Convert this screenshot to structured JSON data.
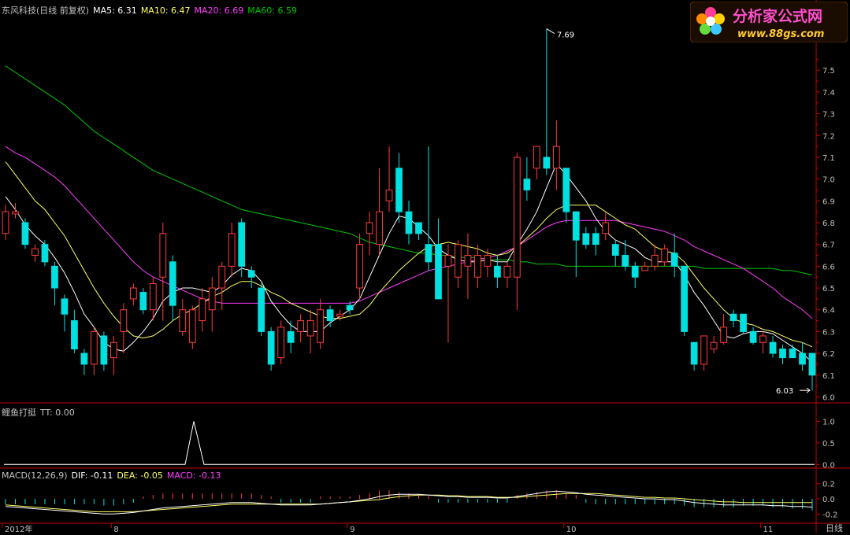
{
  "header": {
    "title": "东风科技(日线 前复权)",
    "ma5": "MA5: 6.31",
    "ma10": "MA10: 6.47",
    "ma20": "MA20: 6.69",
    "ma60": "MA60: 6.59"
  },
  "indicator": {
    "name": "鲤鱼打挺",
    "tt": "TT: 0.00"
  },
  "macd": {
    "name": "MACD(12,26,9)",
    "dif": "DIF: -0.11",
    "dea": "DEA: -0.05",
    "macd": "MACD: -0.13"
  },
  "logo": {
    "title": "分析家公式网",
    "url": "www.88gs.com"
  },
  "period_label": "日线",
  "colors": {
    "up": "#ff3c3c",
    "down": "#00e0e0",
    "ma5": "#ffffff",
    "ma10": "#ffff66",
    "ma20": "#ff3cff",
    "ma60": "#00c800",
    "axis": "#c00000"
  },
  "chart_data": [
    {
      "type": "candlestick",
      "y_ticks": [
        "7.5",
        "7.4",
        "7.3",
        "7.2",
        "7.1",
        "7.0",
        "6.9",
        "6.8",
        "6.7",
        "6.6",
        "6.5",
        "6.4",
        "6.3",
        "6.2",
        "6.1",
        "6.0"
      ],
      "ylim": [
        5.98,
        7.75
      ],
      "annotations": {
        "high": "7.69",
        "low": "6.03"
      },
      "x_labels": [
        "2012年",
        "8",
        "9",
        "10",
        "11"
      ],
      "x_label_positions": [
        0,
        11,
        35,
        57,
        77
      ],
      "candles": [
        [
          6.75,
          6.85,
          6.72,
          6.88
        ],
        [
          6.84,
          6.85,
          6.82,
          6.89
        ],
        [
          6.8,
          6.7,
          6.68,
          6.82
        ],
        [
          6.65,
          6.68,
          6.62,
          6.7
        ],
        [
          6.7,
          6.62,
          6.6,
          6.72
        ],
        [
          6.6,
          6.5,
          6.42,
          6.62
        ],
        [
          6.45,
          6.38,
          6.3,
          6.47
        ],
        [
          6.35,
          6.22,
          6.2,
          6.4
        ],
        [
          6.2,
          6.15,
          6.1,
          6.22
        ],
        [
          6.15,
          6.3,
          6.1,
          6.32
        ],
        [
          6.28,
          6.15,
          6.12,
          6.3
        ],
        [
          6.18,
          6.25,
          6.1,
          6.28
        ],
        [
          6.3,
          6.4,
          6.2,
          6.43
        ],
        [
          6.45,
          6.5,
          6.42,
          6.52
        ],
        [
          6.48,
          6.4,
          6.38,
          6.5
        ],
        [
          6.4,
          6.52,
          6.35,
          6.55
        ],
        [
          6.55,
          6.75,
          6.35,
          6.8
        ],
        [
          6.62,
          6.42,
          6.35,
          6.65
        ],
        [
          6.3,
          6.4,
          6.28,
          6.45
        ],
        [
          6.25,
          6.4,
          6.22,
          6.42
        ],
        [
          6.35,
          6.45,
          6.3,
          6.5
        ],
        [
          6.4,
          6.5,
          6.3,
          6.55
        ],
        [
          6.5,
          6.6,
          6.4,
          6.62
        ],
        [
          6.6,
          6.75,
          6.55,
          6.8
        ],
        [
          6.8,
          6.6,
          6.55,
          6.82
        ],
        [
          6.58,
          6.55,
          6.5,
          6.6
        ],
        [
          6.5,
          6.3,
          6.28,
          6.52
        ],
        [
          6.3,
          6.15,
          6.12,
          6.32
        ],
        [
          6.18,
          6.32,
          6.15,
          6.35
        ],
        [
          6.3,
          6.25,
          6.2,
          6.35
        ],
        [
          6.3,
          6.35,
          6.25,
          6.38
        ],
        [
          6.28,
          6.35,
          6.2,
          6.4
        ],
        [
          6.25,
          6.4,
          6.22,
          6.45
        ],
        [
          6.4,
          6.35,
          6.32,
          6.42
        ],
        [
          6.37,
          6.38,
          6.35,
          6.4
        ],
        [
          6.42,
          6.4,
          6.38,
          6.44
        ],
        [
          6.5,
          6.7,
          6.45,
          6.75
        ],
        [
          6.75,
          6.8,
          6.65,
          6.85
        ],
        [
          6.7,
          6.85,
          6.65,
          7.05
        ],
        [
          6.9,
          6.95,
          6.85,
          7.15
        ],
        [
          7.05,
          6.85,
          6.8,
          7.12
        ],
        [
          6.85,
          6.75,
          6.7,
          6.9
        ],
        [
          6.8,
          6.75,
          6.72,
          6.8
        ],
        [
          6.7,
          6.62,
          6.58,
          7.15
        ],
        [
          6.7,
          6.45,
          6.45,
          6.82
        ],
        [
          6.6,
          6.65,
          6.25,
          6.7
        ],
        [
          6.55,
          6.7,
          6.5,
          6.72
        ],
        [
          6.6,
          6.65,
          6.45,
          6.75
        ],
        [
          6.55,
          6.65,
          6.5,
          6.7
        ],
        [
          6.6,
          6.65,
          6.55,
          6.68
        ],
        [
          6.6,
          6.55,
          6.5,
          6.65
        ],
        [
          6.55,
          6.6,
          6.5,
          6.62
        ],
        [
          6.55,
          7.1,
          6.4,
          7.12
        ],
        [
          7.0,
          6.95,
          6.9,
          7.1
        ],
        [
          7.05,
          7.15,
          7.0,
          7.15
        ],
        [
          7.1,
          7.05,
          7.02,
          7.69
        ],
        [
          7.05,
          7.15,
          6.95,
          7.27
        ],
        [
          7.05,
          6.85,
          6.8,
          7.05
        ],
        [
          6.85,
          6.72,
          6.55,
          6.85
        ],
        [
          6.75,
          6.7,
          6.68,
          6.78
        ],
        [
          6.75,
          6.7,
          6.65,
          6.78
        ],
        [
          6.75,
          6.8,
          6.72,
          6.85
        ],
        [
          6.7,
          6.65,
          6.6,
          6.72
        ],
        [
          6.65,
          6.6,
          6.58,
          6.72
        ],
        [
          6.6,
          6.55,
          6.5,
          6.62
        ],
        [
          6.58,
          6.6,
          6.58,
          6.62
        ],
        [
          6.6,
          6.65,
          6.58,
          6.7
        ],
        [
          6.62,
          6.68,
          6.6,
          6.7
        ],
        [
          6.66,
          6.6,
          6.55,
          6.75
        ],
        [
          6.6,
          6.3,
          6.28,
          6.6
        ],
        [
          6.25,
          6.15,
          6.12,
          6.25
        ],
        [
          6.15,
          6.28,
          6.12,
          6.28
        ],
        [
          6.22,
          6.25,
          6.2,
          6.28
        ],
        [
          6.25,
          6.32,
          6.24,
          6.38
        ],
        [
          6.38,
          6.35,
          6.32,
          6.4
        ],
        [
          6.38,
          6.3,
          6.29,
          6.38
        ],
        [
          6.3,
          6.25,
          6.24,
          6.32
        ],
        [
          6.25,
          6.28,
          6.2,
          6.3
        ],
        [
          6.25,
          6.2,
          6.18,
          6.28
        ],
        [
          6.22,
          6.18,
          6.15,
          6.24
        ],
        [
          6.22,
          6.18,
          6.18,
          6.24
        ],
        [
          6.2,
          6.15,
          6.12,
          6.25
        ],
        [
          6.2,
          6.1,
          6.03,
          6.2
        ]
      ],
      "ma_series": {
        "ma5": [
          6.92,
          6.86,
          6.79,
          6.74,
          6.7,
          6.64,
          6.57,
          6.48,
          6.38,
          6.32,
          6.25,
          6.22,
          6.21,
          6.25,
          6.3,
          6.36,
          6.44,
          6.48,
          6.5,
          6.5,
          6.49,
          6.48,
          6.51,
          6.56,
          6.59,
          6.58,
          6.53,
          6.44,
          6.38,
          6.33,
          6.3,
          6.3,
          6.3,
          6.34,
          6.37,
          6.4,
          6.45,
          6.55,
          6.65,
          6.75,
          6.83,
          6.82,
          6.78,
          6.74,
          6.68,
          6.65,
          6.63,
          6.62,
          6.62,
          6.63,
          6.62,
          6.62,
          6.7,
          6.77,
          6.85,
          6.96,
          7.07,
          7.02,
          6.96,
          6.9,
          6.82,
          6.76,
          6.72,
          6.7,
          6.68,
          6.64,
          6.62,
          6.62,
          6.62,
          6.56,
          6.48,
          6.42,
          6.35,
          6.28,
          6.27,
          6.29,
          6.3,
          6.3,
          6.29,
          6.26,
          6.23,
          6.2,
          6.16
        ],
        "ma10": [
          7.08,
          7.02,
          6.96,
          6.9,
          6.86,
          6.8,
          6.74,
          6.66,
          6.58,
          6.5,
          6.43,
          6.37,
          6.32,
          6.28,
          6.27,
          6.28,
          6.31,
          6.35,
          6.38,
          6.4,
          6.43,
          6.46,
          6.48,
          6.51,
          6.53,
          6.53,
          6.51,
          6.48,
          6.46,
          6.43,
          6.41,
          6.39,
          6.37,
          6.36,
          6.36,
          6.37,
          6.38,
          6.42,
          6.48,
          6.53,
          6.58,
          6.62,
          6.66,
          6.69,
          6.7,
          6.71,
          6.7,
          6.69,
          6.68,
          6.66,
          6.65,
          6.66,
          6.69,
          6.73,
          6.77,
          6.82,
          6.86,
          6.88,
          6.88,
          6.88,
          6.88,
          6.85,
          6.82,
          6.79,
          6.77,
          6.73,
          6.69,
          6.67,
          6.66,
          6.62,
          6.56,
          6.5,
          6.45,
          6.4,
          6.36,
          6.34,
          6.33,
          6.31,
          6.3,
          6.28,
          6.26,
          6.25,
          6.23
        ],
        "ma20": [
          7.15,
          7.12,
          7.1,
          7.07,
          7.04,
          7.01,
          6.97,
          6.92,
          6.87,
          6.82,
          6.77,
          6.72,
          6.67,
          6.62,
          6.58,
          6.55,
          6.53,
          6.51,
          6.49,
          6.47,
          6.45,
          6.44,
          6.43,
          6.43,
          6.43,
          6.43,
          6.43,
          6.43,
          6.43,
          6.43,
          6.43,
          6.43,
          6.43,
          6.43,
          6.43,
          6.43,
          6.44,
          6.46,
          6.48,
          6.5,
          6.52,
          6.54,
          6.56,
          6.58,
          6.59,
          6.6,
          6.61,
          6.62,
          6.63,
          6.64,
          6.65,
          6.67,
          6.69,
          6.72,
          6.75,
          6.78,
          6.8,
          6.81,
          6.81,
          6.81,
          6.81,
          6.81,
          6.81,
          6.8,
          6.79,
          6.78,
          6.77,
          6.76,
          6.74,
          6.72,
          6.69,
          6.67,
          6.65,
          6.63,
          6.61,
          6.59,
          6.56,
          6.53,
          6.5,
          6.46,
          6.43,
          6.4,
          6.36
        ],
        "ma60": [
          7.52,
          7.49,
          7.46,
          7.43,
          7.4,
          7.37,
          7.34,
          7.3,
          7.26,
          7.22,
          7.19,
          7.16,
          7.13,
          7.1,
          7.07,
          7.04,
          7.02,
          7.0,
          6.98,
          6.96,
          6.94,
          6.92,
          6.9,
          6.88,
          6.86,
          6.85,
          6.84,
          6.83,
          6.82,
          6.81,
          6.8,
          6.79,
          6.78,
          6.77,
          6.76,
          6.75,
          6.73,
          6.71,
          6.7,
          6.69,
          6.68,
          6.67,
          6.66,
          6.66,
          6.65,
          6.65,
          6.64,
          6.64,
          6.64,
          6.63,
          6.63,
          6.63,
          6.62,
          6.62,
          6.61,
          6.61,
          6.61,
          6.6,
          6.6,
          6.6,
          6.6,
          6.6,
          6.6,
          6.6,
          6.6,
          6.6,
          6.6,
          6.6,
          6.6,
          6.6,
          6.6,
          6.59,
          6.59,
          6.59,
          6.59,
          6.59,
          6.59,
          6.59,
          6.59,
          6.58,
          6.58,
          6.57,
          6.56
        ]
      }
    },
    {
      "type": "line",
      "series_name": "TT",
      "y_ticks": [
        "1.0",
        "0.5",
        "0.0"
      ],
      "ylim": [
        -0.05,
        1.1
      ],
      "values": [
        0,
        0,
        0,
        0,
        0,
        0,
        0,
        0,
        0,
        0,
        0,
        0,
        0,
        0,
        0,
        0,
        0,
        0,
        0,
        0,
        0,
        0,
        0,
        0,
        0,
        0,
        0,
        0,
        0,
        0,
        0,
        0,
        0,
        0,
        0,
        0,
        0,
        0,
        0,
        0,
        0,
        0,
        0,
        0,
        0,
        0,
        0,
        0,
        0,
        0,
        0,
        0,
        0,
        0,
        0,
        0,
        0,
        0,
        0,
        0,
        0,
        0,
        0,
        0,
        0,
        0,
        0,
        0,
        0,
        0,
        0,
        0,
        0,
        0,
        0,
        0,
        0,
        0,
        0,
        0,
        0,
        0,
        0
      ],
      "spikes": [
        {
          "x": 246,
          "value": 1.0
        }
      ]
    },
    {
      "type": "macd",
      "y_ticks": [
        "0.2",
        "0.0",
        "-0.2"
      ],
      "ylim": [
        -0.3,
        0.3
      ],
      "dif": [
        -0.1,
        -0.11,
        -0.12,
        -0.13,
        -0.14,
        -0.15,
        -0.16,
        -0.17,
        -0.18,
        -0.19,
        -0.2,
        -0.2,
        -0.19,
        -0.18,
        -0.16,
        -0.14,
        -0.12,
        -0.11,
        -0.1,
        -0.09,
        -0.08,
        -0.07,
        -0.06,
        -0.05,
        -0.05,
        -0.05,
        -0.06,
        -0.07,
        -0.08,
        -0.08,
        -0.08,
        -0.08,
        -0.07,
        -0.06,
        -0.05,
        -0.04,
        -0.02,
        0.0,
        0.03,
        0.05,
        0.06,
        0.06,
        0.06,
        0.05,
        0.04,
        0.03,
        0.03,
        0.02,
        0.02,
        0.02,
        0.01,
        0.01,
        0.03,
        0.05,
        0.07,
        0.09,
        0.1,
        0.09,
        0.08,
        0.06,
        0.05,
        0.04,
        0.03,
        0.02,
        0.01,
        0.0,
        0.0,
        -0.01,
        -0.01,
        -0.03,
        -0.05,
        -0.06,
        -0.07,
        -0.08,
        -0.08,
        -0.08,
        -0.08,
        -0.08,
        -0.09,
        -0.09,
        -0.1,
        -0.1,
        -0.11
      ],
      "dea": [
        -0.08,
        -0.09,
        -0.1,
        -0.11,
        -0.12,
        -0.13,
        -0.14,
        -0.15,
        -0.16,
        -0.17,
        -0.17,
        -0.17,
        -0.17,
        -0.17,
        -0.16,
        -0.15,
        -0.14,
        -0.13,
        -0.12,
        -0.11,
        -0.1,
        -0.09,
        -0.08,
        -0.07,
        -0.07,
        -0.07,
        -0.07,
        -0.07,
        -0.07,
        -0.07,
        -0.07,
        -0.07,
        -0.07,
        -0.06,
        -0.05,
        -0.04,
        -0.03,
        -0.02,
        -0.01,
        0.01,
        0.03,
        0.04,
        0.05,
        0.05,
        0.05,
        0.04,
        0.04,
        0.03,
        0.03,
        0.03,
        0.02,
        0.02,
        0.02,
        0.03,
        0.04,
        0.05,
        0.06,
        0.07,
        0.07,
        0.07,
        0.07,
        0.06,
        0.05,
        0.04,
        0.03,
        0.02,
        0.02,
        0.01,
        0.01,
        0.0,
        -0.01,
        -0.02,
        -0.03,
        -0.04,
        -0.04,
        -0.05,
        -0.05,
        -0.05,
        -0.05,
        -0.05,
        -0.05,
        -0.05,
        -0.05
      ]
    }
  ]
}
